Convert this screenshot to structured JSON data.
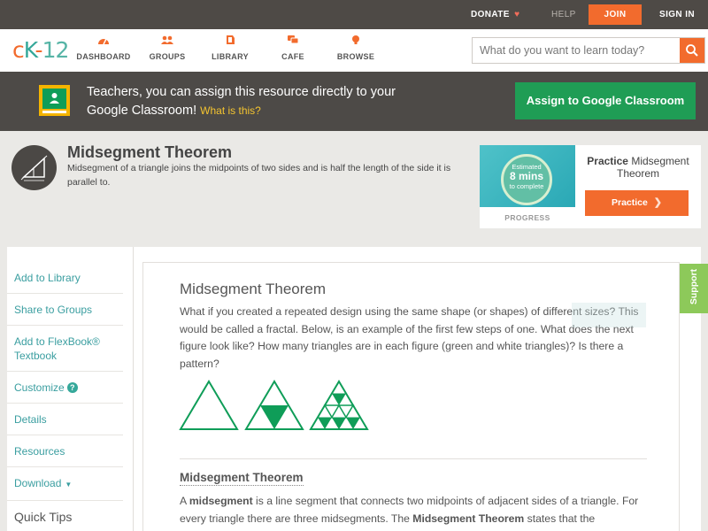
{
  "topbar": {
    "donate": "DONATE",
    "help": "HELP",
    "join": "JOIN",
    "signin": "SIGN IN"
  },
  "brand": {
    "logo_c": "c",
    "logo_k": "K",
    "logo_dash": "-",
    "logo_num": "12"
  },
  "nav": {
    "dashboard": "DASHBOARD",
    "groups": "GROUPS",
    "library": "LIBRARY",
    "cafe": "CAFE",
    "browse": "BROWSE"
  },
  "search": {
    "placeholder": "What do you want to learn today?"
  },
  "classroom": {
    "message": "Teachers, you can assign this resource directly to your Google Classroom!",
    "what": "What is this?",
    "button": "Assign to Google Classroom"
  },
  "concept": {
    "title": "Midsegment Theorem",
    "description": "Midsegment of a triangle joins the midpoints of two sides and is half the length of the side it is parallel to."
  },
  "practice": {
    "estimated": "Estimated",
    "mins": "8 mins",
    "to_complete": "to complete",
    "progress_label": "PROGRESS",
    "name_bold": "Practice",
    "name_rest": "Midsegment Theorem",
    "button": "Practice"
  },
  "sidebar": {
    "add_library": "Add to Library",
    "share_groups": "Share to Groups",
    "add_flexbook": "Add to FlexBook® Textbook",
    "customize": "Customize",
    "details": "Details",
    "resources": "Resources",
    "download": "Download",
    "quick_tips": "Quick Tips"
  },
  "article": {
    "title": "Midsegment Theorem",
    "intro": "What if you created a repeated design using the same shape (or shapes) of different sizes? This would be called a fractal. Below, is an example of the first few steps of one. What does the next figure look like? How many triangles are in each figure (green and white triangles)? Is there a pattern?",
    "section_title": "Midsegment Theorem",
    "p2_a": "A ",
    "p2_b": "midsegment",
    "p2_c": " is a line segment that connects two midpoints of adjacent sides of a triangle. For every triangle there are three midsegments. The ",
    "p2_d": "Midsegment Theorem",
    "p2_e": " states that the"
  },
  "support": "Support",
  "colors": {
    "accent_orange": "#f26b2d",
    "teal": "#35a89a",
    "classroom_green": "#1f9d55",
    "fractal_green": "#0f9d58"
  }
}
